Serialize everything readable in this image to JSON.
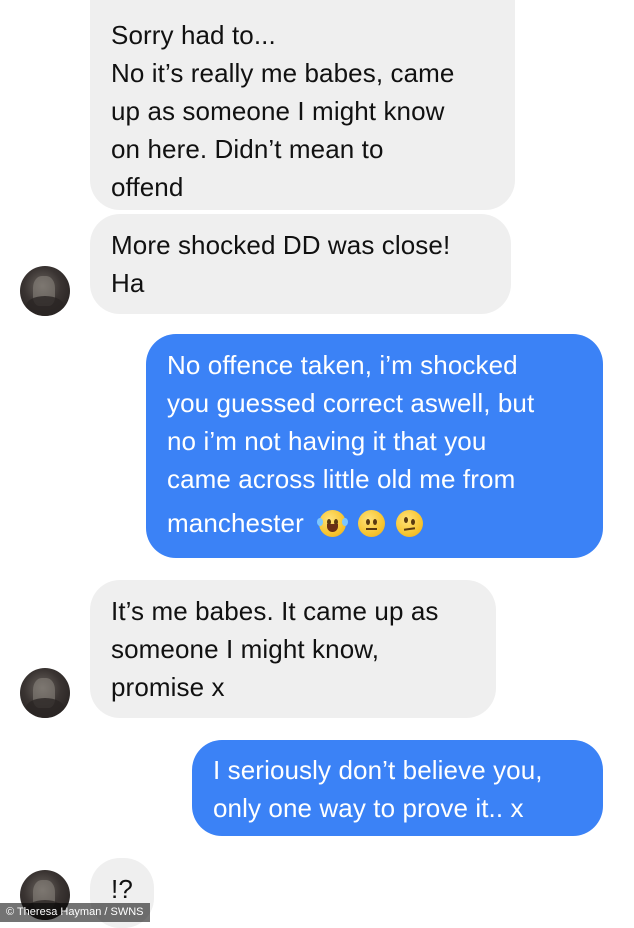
{
  "conversation": {
    "messages": [
      {
        "sender": "other",
        "lines": [
          "Sorry had to...",
          "No it’s really me babes, came",
          "up as someone I might know",
          "on here. Didn’t mean to",
          "offend"
        ]
      },
      {
        "sender": "other",
        "lines": [
          "More shocked DD was close!",
          "Ha"
        ]
      },
      {
        "sender": "me",
        "lines": [
          "No offence taken, i’m shocked",
          "you guessed correct aswell, but",
          "no i’m not having it that you",
          "came across little old me from",
          "manchester"
        ],
        "emojis": [
          "laughing-tears-emoji",
          "neutral-face-emoji",
          "raised-eyebrow-emoji"
        ]
      },
      {
        "sender": "other",
        "lines": [
          "It’s me babes. It came up as",
          "someone I might know,",
          "promise x"
        ]
      },
      {
        "sender": "me",
        "lines": [
          "I seriously don’t believe you,",
          "only one way to prove it.. x"
        ]
      },
      {
        "sender": "other",
        "lines": [
          "!?"
        ]
      }
    ]
  },
  "credit": "© Theresa Hayman / SWNS",
  "colors": {
    "incoming_bubble": "#efefef",
    "outgoing_bubble": "#3b82f6",
    "background": "#ffffff"
  }
}
